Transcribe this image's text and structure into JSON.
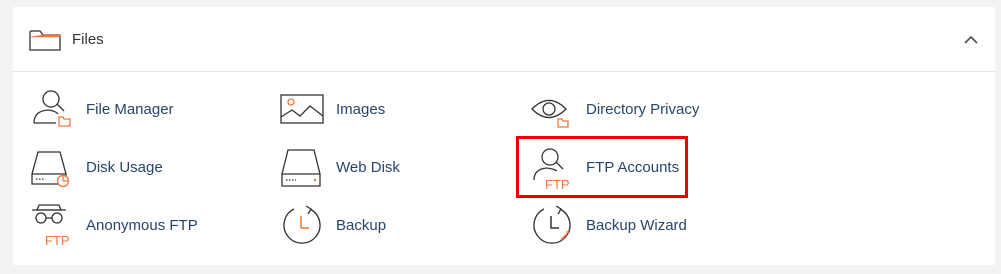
{
  "section": {
    "title": "Files",
    "collapse_icon": "chevron-up-icon"
  },
  "items": [
    {
      "label": "File Manager",
      "icon": "file-manager-icon"
    },
    {
      "label": "Images",
      "icon": "images-icon"
    },
    {
      "label": "Directory Privacy",
      "icon": "directory-privacy-icon"
    },
    {
      "label": "Disk Usage",
      "icon": "disk-usage-icon"
    },
    {
      "label": "Web Disk",
      "icon": "web-disk-icon"
    },
    {
      "label": "FTP Accounts",
      "icon": "ftp-accounts-icon"
    },
    {
      "label": "Anonymous FTP",
      "icon": "anonymous-ftp-icon"
    },
    {
      "label": "Backup",
      "icon": "backup-icon"
    },
    {
      "label": "Backup Wizard",
      "icon": "backup-wizard-icon"
    }
  ],
  "icon_text": {
    "ftp": "FTP"
  },
  "highlighted_item": "FTP Accounts",
  "colors": {
    "link": "#27456b",
    "accent": "#f0763f",
    "highlight": "#ee0000"
  }
}
